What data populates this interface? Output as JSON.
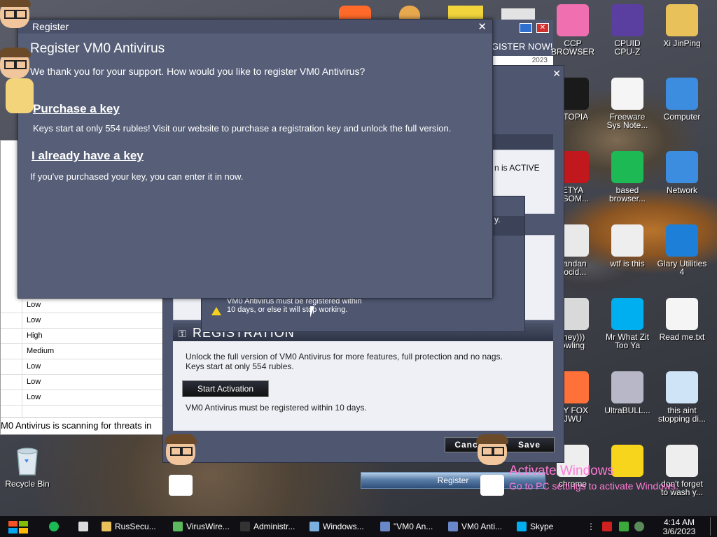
{
  "desktop": {
    "icons_right": [
      {
        "label": "CCP\nBROWSER",
        "icon": "pinwheel-icon",
        "color": "#f06fb0"
      },
      {
        "label": "CPUID\nCPU-Z",
        "icon": "cpuz-icon",
        "color": "#5b3fa0"
      },
      {
        "label": "Xi JinPing",
        "icon": "folder-user-icon",
        "color": "#e8c15a"
      },
      {
        "label": "UTOPIA",
        "icon": "utopia-icon",
        "color": "#1a1a1a"
      },
      {
        "label": "Freeware\nSys Note...",
        "icon": "document-icon",
        "color": "#f5f5f5"
      },
      {
        "label": "Computer",
        "icon": "computer-icon",
        "color": "#3c8de0"
      },
      {
        "label": "ETYA\nNSOM...",
        "icon": "skull-icon",
        "color": "#c0181c"
      },
      {
        "label": "based\nbrowser...",
        "icon": "spotify-icon",
        "color": "#1db954"
      },
      {
        "label": "Network",
        "icon": "network-icon",
        "color": "#3c8de0"
      },
      {
        "label": "vandan\nnocid...",
        "icon": "meme-icon",
        "color": "#e9e9e9"
      },
      {
        "label": "wtf is this",
        "icon": "window-icon",
        "color": "#eeeeee"
      },
      {
        "label": "Glary Utilities\n4",
        "icon": "glary-icon",
        "color": "#1e7fd8"
      },
      {
        "label": "they)))\nowling",
        "icon": "clown-icon",
        "color": "#d9d9d9"
      },
      {
        "label": "Mr What Zit\nToo Ya",
        "icon": "skype-icon",
        "color": "#00aff0"
      },
      {
        "label": "Read me.txt",
        "icon": "text-file-icon",
        "color": "#f5f5f5"
      },
      {
        "label": "RY FOX\nJWU",
        "icon": "firefox-icon",
        "color": "#ff7139"
      },
      {
        "label": "UltraBULL...",
        "icon": "disc-icon",
        "color": "#b7b7c8"
      },
      {
        "label": "this aint\nstopping di...",
        "icon": "setup-icon",
        "color": "#cfe4f7"
      },
      {
        "label": "chrome",
        "icon": "chrome-icon",
        "color": "#eeeeee"
      },
      {
        "label": "",
        "icon": "star-icon",
        "color": "#f7d51d"
      },
      {
        "label": "don't forget\nto wash y...",
        "icon": "window-icon",
        "color": "#eeeeee"
      }
    ],
    "recycle_bin": "Recycle Bin",
    "top_strip": {
      "register_now": "GISTER NOW!",
      "partial_text": "2023"
    }
  },
  "background_app": {
    "rows": [
      "Low",
      "Low",
      "High",
      "Medium",
      "Low",
      "Low",
      "Low"
    ],
    "status": "M0 Antivirus is scanning for threats in"
  },
  "vm0_window": {
    "side_text_1": "n is ACTIVE",
    "side_text_2": "y.",
    "registration_header": "REGISTRATION",
    "registration_text_1": "Unlock the full version of VM0 Antivirus for more features, full protection and no nags.",
    "registration_text_2": "Keys start at only 554 rubles.",
    "start_activation": "Start Activation",
    "registration_note": "VM0 Antivirus must be registered within 10 days.",
    "cancel": "Canc",
    "save": "Save",
    "register_button": "Register"
  },
  "warning_popup": {
    "message": "VM0 Antivirus must be registered within 10 days, or else it will stop working."
  },
  "register_dialog": {
    "window_title": "Register",
    "heading": "Register VM0 Antivirus",
    "intro": "We thank you for your support. How would you like to register VM0 Antivirus?",
    "purchase_link": "Purchase a key",
    "purchase_desc": "Keys start at only 554 rubles! Visit our website to purchase a registration key and unlock the full version.",
    "have_key_link": "I already have a key",
    "have_key_desc": "If you've purchased your key, you can enter it in now."
  },
  "watermark": {
    "title": "Activate Windows",
    "subtitle": "Go to PC settings to activate Windows."
  },
  "taskbar": {
    "items": [
      {
        "label": "RusSecu...",
        "icon": "folder-icon",
        "color": "#e8c15a"
      },
      {
        "label": "VirusWire...",
        "icon": "viruswire-icon",
        "color": "#5cb85c"
      },
      {
        "label": "Administr...",
        "icon": "cmd-icon",
        "color": "#333333"
      },
      {
        "label": "Windows...",
        "icon": "window-icon",
        "color": "#7ab0e0"
      },
      {
        "label": "\"VM0 An...",
        "icon": "shield-icon",
        "color": "#6a87c9"
      },
      {
        "label": "VM0 Anti...",
        "icon": "shield-icon",
        "color": "#6a87c9"
      },
      {
        "label": "Skype",
        "icon": "skype-icon",
        "color": "#00aff0"
      }
    ],
    "clock_time": "4:14 AM",
    "clock_date": "3/6/2023"
  }
}
